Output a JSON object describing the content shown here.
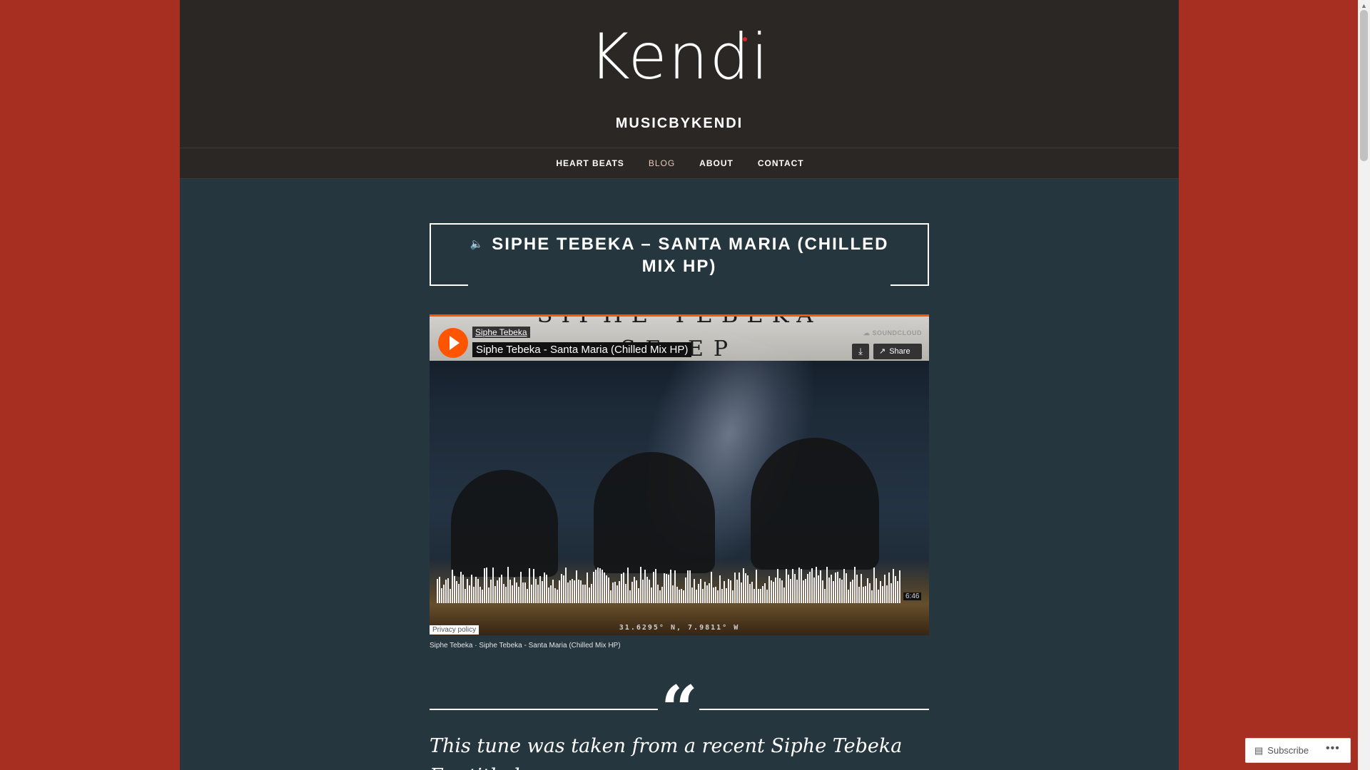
{
  "site": {
    "logo_text": "Kendi",
    "title": "MUSICBYKENDI"
  },
  "nav": {
    "items": [
      {
        "label": "HEART BEATS"
      },
      {
        "label": "BLOG"
      },
      {
        "label": "ABOUT"
      },
      {
        "label": "CONTACT"
      }
    ],
    "current": "BLOG"
  },
  "post": {
    "title": "SIPHE TEBEKA – SANTA MARIA (CHILLED MIX HP)",
    "format_icon": "audio-speaker-icon",
    "caption_artist": "Siphe Tebeka",
    "caption_separator": " · ",
    "caption_track": "Siphe Tebeka - Santa Maria (Chilled Mix HP)",
    "quote_text": "This tune was taken from a recent Siphe Tebeka E.p titled"
  },
  "player": {
    "artist": "Siphe Tebeka",
    "track": "Siphe Tebeka - Santa Maria (Chilled Mix HP)",
    "brand": "SOUNDCLOUD",
    "banner_text": "SE EP",
    "banner_top": "SIPHE TEBEKA",
    "share_label": "Share",
    "duration": "6:46",
    "privacy_label": "Privacy policy",
    "coordinates": "31.6295° N, 7.9811° W",
    "accent_color": "#ff5500"
  },
  "widgets": {
    "subscribe_label": "Subscribe",
    "more_label": "•••"
  },
  "colors": {
    "outer_background": "#a72f22",
    "header_background": "#2a2725",
    "content_background": "#25363e"
  }
}
